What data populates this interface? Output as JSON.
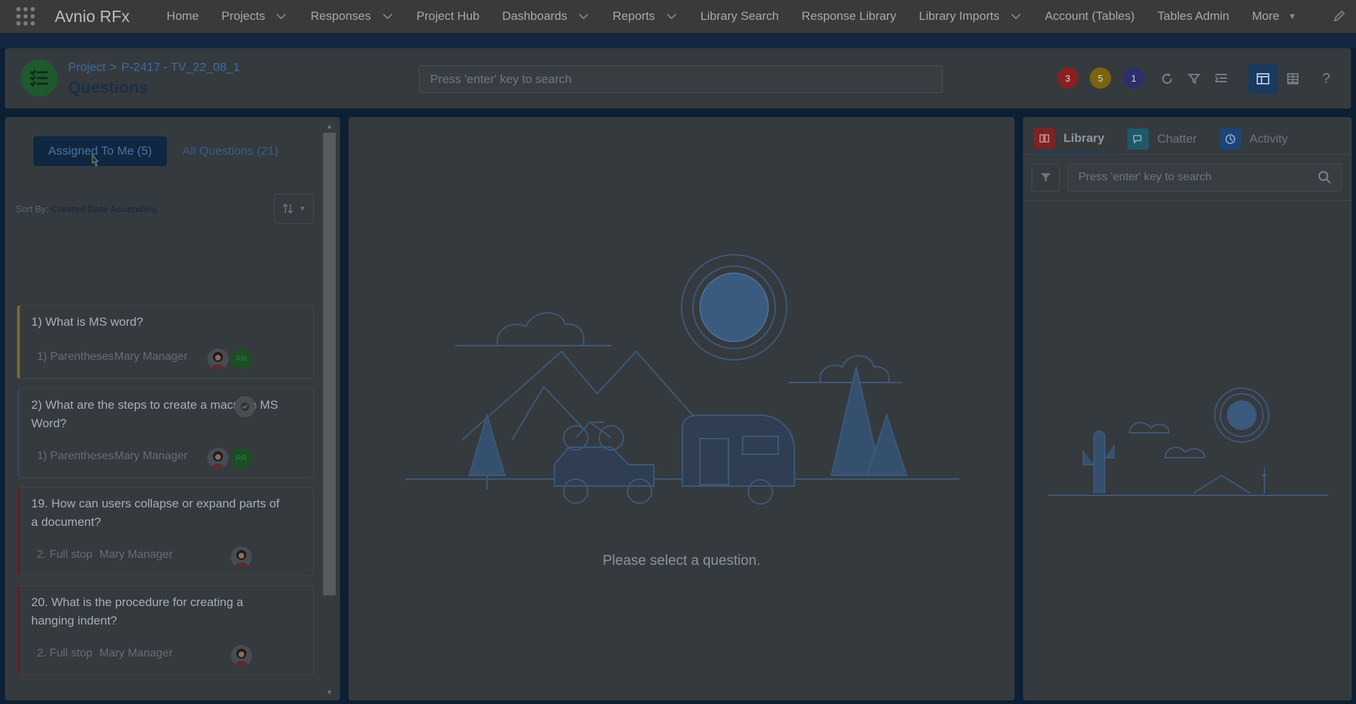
{
  "app": {
    "name": "Avnio RFx"
  },
  "nav": {
    "items": [
      {
        "label": "Home",
        "dropdown": false
      },
      {
        "label": "Projects",
        "dropdown": true
      },
      {
        "label": "Responses",
        "dropdown": true
      },
      {
        "label": "Project Hub",
        "dropdown": false
      },
      {
        "label": "Dashboards",
        "dropdown": true
      },
      {
        "label": "Reports",
        "dropdown": true
      },
      {
        "label": "Library Search",
        "dropdown": false
      },
      {
        "label": "Response Library",
        "dropdown": false
      },
      {
        "label": "Library Imports",
        "dropdown": true
      },
      {
        "label": "Account (Tables)",
        "dropdown": false
      },
      {
        "label": "Tables Admin",
        "dropdown": false
      }
    ],
    "more_label": "More"
  },
  "header": {
    "breadcrumb_root": "Project",
    "breadcrumb_separator": ">",
    "breadcrumb_project": "P-2417 - TV_22_08_1",
    "title": "Questions",
    "search_placeholder": "Press 'enter' key to search",
    "status_counts": [
      {
        "value": "3",
        "color": "#8a1f1f"
      },
      {
        "value": "5",
        "color": "#7a6410"
      },
      {
        "value": "1",
        "color": "#2b2f6b"
      }
    ]
  },
  "questions_panel": {
    "tabs": {
      "assigned": "Assigned To Me (5)",
      "all": "All Questions (21)"
    },
    "sort_prefix": "Sort By:",
    "sort_value": "Created Date Ascending",
    "items": [
      {
        "text": "1) What is MS word?",
        "section": "1) Parentheses",
        "owner": "Mary Manager",
        "bar_color": "#7a6a1e",
        "initials": "RR",
        "reviewed": false
      },
      {
        "text": "2) What are the steps to create a macro in MS Word?",
        "section": "1) Parentheses",
        "owner": "Mary Manager",
        "bar_color": "#3a3f5e",
        "initials": "RR",
        "reviewed": true
      },
      {
        "text": "19. How can users collapse or expand parts of a document?",
        "section": "2. Full stop",
        "owner": "Mary Manager",
        "bar_color": "#6b1d1d",
        "initials": "",
        "reviewed": false
      },
      {
        "text": "20. What is the procedure for creating a hanging indent?",
        "section": "2. Full stop",
        "owner": "Mary Manager",
        "bar_color": "#6b1d1d",
        "initials": "",
        "reviewed": false
      }
    ]
  },
  "center": {
    "empty_message": "Please select a question."
  },
  "right_panel": {
    "tabs": [
      {
        "label": "Library",
        "icon": "book-icon",
        "color": "#7a2424"
      },
      {
        "label": "Chatter",
        "icon": "chat-icon",
        "color": "#1f5868"
      },
      {
        "label": "Activity",
        "icon": "clock-icon",
        "color": "#1d4575"
      }
    ],
    "search_placeholder": "Press 'enter' key to search"
  }
}
